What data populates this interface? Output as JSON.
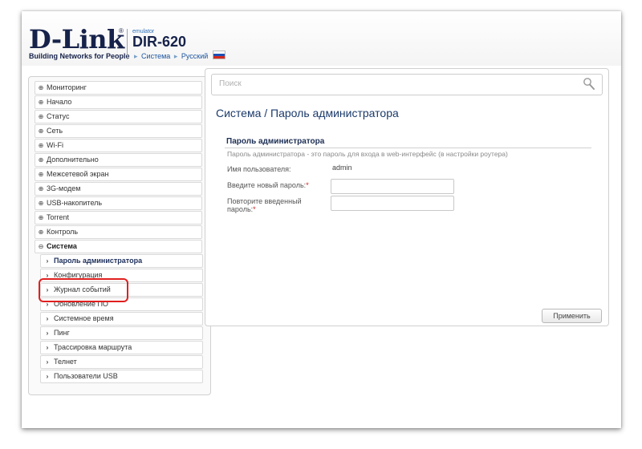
{
  "header": {
    "logo_text": "D-Link",
    "logo_reg": "®",
    "tagline": "Building Networks for People",
    "emulator_label": "emulator",
    "model": "DIR-620",
    "breadcrumb": {
      "sep": "▸",
      "item1": "Система",
      "item2": "Русский"
    }
  },
  "sidebar": {
    "items": [
      {
        "label": "Мониторинг",
        "icon": "expand-icon"
      },
      {
        "label": "Начало",
        "icon": "expand-icon"
      },
      {
        "label": "Статус",
        "icon": "expand-icon"
      },
      {
        "label": "Сеть",
        "icon": "expand-icon"
      },
      {
        "label": "Wi-Fi",
        "icon": "expand-icon"
      },
      {
        "label": "Дополнительно",
        "icon": "expand-icon"
      },
      {
        "label": "Межсетевой экран",
        "icon": "expand-icon"
      },
      {
        "label": "3G-модем",
        "icon": "expand-icon"
      },
      {
        "label": "USB-накопитель",
        "icon": "expand-icon"
      },
      {
        "label": "Torrent",
        "icon": "expand-icon"
      },
      {
        "label": "Контроль",
        "icon": "expand-icon"
      },
      {
        "label": "Система",
        "icon": "collapse-icon"
      }
    ],
    "sub_items": [
      {
        "label": "Пароль администратора"
      },
      {
        "label": "Конфигурация"
      },
      {
        "label": "Журнал событий"
      },
      {
        "label": "Обновление ПО"
      },
      {
        "label": "Системное время"
      },
      {
        "label": "Пинг"
      },
      {
        "label": "Трассировка маршрута"
      },
      {
        "label": "Телнет"
      },
      {
        "label": "Пользователи USB"
      }
    ],
    "expand_glyph": "⊕",
    "collapse_glyph": "⊖",
    "sub_glyph": "›"
  },
  "main": {
    "search_placeholder": "Поиск",
    "page_title": "Система /  Пароль администратора",
    "section_title": "Пароль администратора",
    "section_desc": "Пароль администратора - это пароль для входа в web-интерфейс (в настройки роутера)",
    "username_label": "Имя пользователя:",
    "username_value": "admin",
    "new_password_label": "Введите новый пароль:",
    "repeat_password_label": "Повторите введенный пароль:",
    "required_mark": "*",
    "apply_label": "Применить"
  },
  "colors": {
    "brand": "#16224a",
    "accent": "#1d55a0",
    "highlight": "#e02020"
  }
}
